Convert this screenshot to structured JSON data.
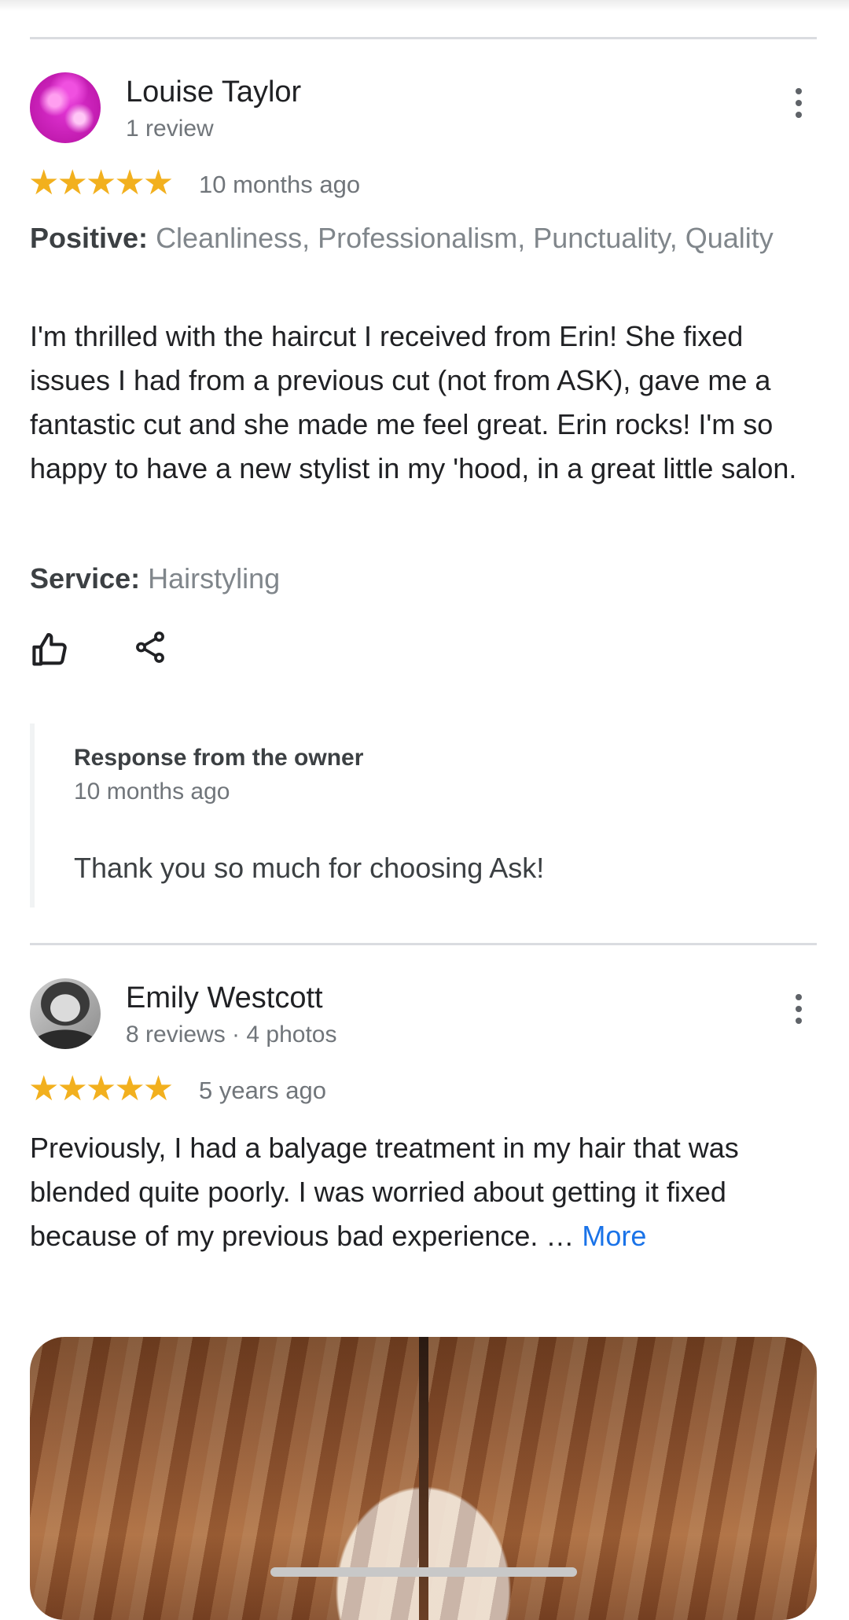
{
  "reviews": [
    {
      "author": "Louise Taylor",
      "meta": "1 review",
      "stars": "★★★★★",
      "rating": 5,
      "time": "10 months ago",
      "positive_label": "Positive:",
      "positive_values": "Cleanliness, Professionalism, Punctuality, Quality",
      "text": "I'm thrilled with the haircut I received from Erin! She fixed issues I had from a previous cut (not from ASK), gave me a fantastic cut and she made me feel great. Erin rocks! I'm so happy to have a new stylist in my 'hood, in a great little salon.",
      "service_label": "Service:",
      "service_value": "Hairstyling",
      "like_icon": "thumbs-up-icon",
      "share_icon": "share-icon",
      "owner_response": {
        "title": "Response from the owner",
        "time": "10 months ago",
        "text": "Thank you so much for choosing Ask!"
      }
    },
    {
      "author": "Emily Westcott",
      "meta": "8 reviews · 4 photos",
      "stars": "★★★★★",
      "rating": 5,
      "time": "5 years ago",
      "text": "Previously, I had a balyage treatment in my hair that was blended quite poorly. I was worried about getting it fixed because of my previous bad experience. …",
      "more_label": "More"
    }
  ],
  "colors": {
    "star": "#f2b01e",
    "link": "#1a73e8",
    "divider": "#dadce0"
  }
}
